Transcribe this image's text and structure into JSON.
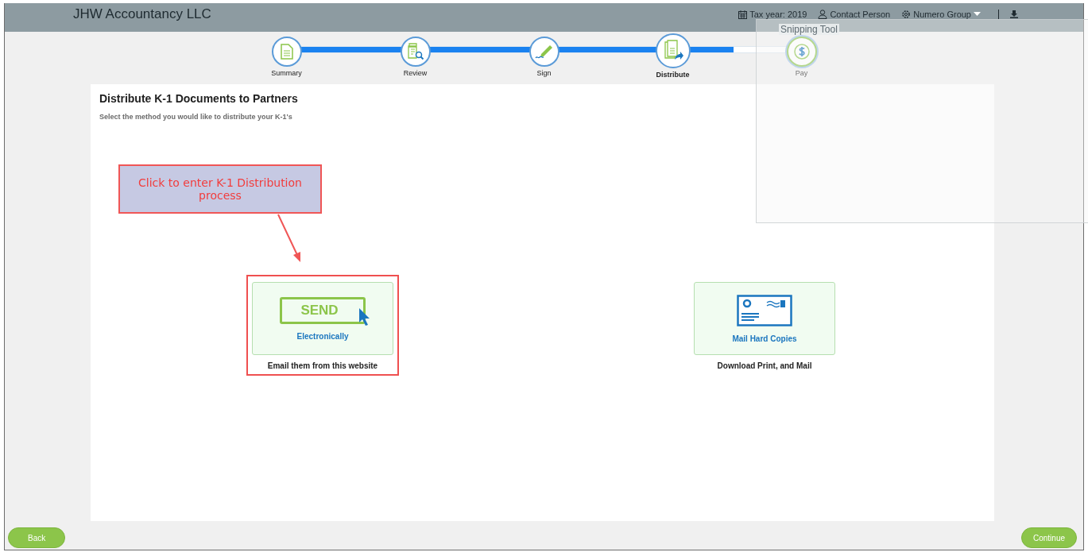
{
  "header": {
    "title": "JHW Accountancy LLC",
    "tax_year": "Tax year: 2019",
    "contact": "Contact Person",
    "group": "Numero Group"
  },
  "overlay_window": {
    "title": "Snipping Tool"
  },
  "steps": [
    {
      "label": "Summary",
      "kind": "summary",
      "completed": true,
      "selected": false
    },
    {
      "label": "Review",
      "kind": "review",
      "completed": true,
      "selected": false
    },
    {
      "label": "Sign",
      "kind": "sign",
      "completed": true,
      "selected": false
    },
    {
      "label": "Distribute",
      "kind": "distribute",
      "completed": true,
      "selected": true
    },
    {
      "label": "Pay",
      "kind": "pay",
      "completed": false,
      "selected": false
    }
  ],
  "panel": {
    "title": "Distribute K-1 Documents to Partners",
    "subtitle": "Select the method you would like to distribute your K-1's"
  },
  "callout": {
    "text": "Click to enter K-1 Distribution process"
  },
  "options": [
    {
      "kind": "send",
      "label": "Electronically",
      "caption": "Email them from this website",
      "highlighted": true,
      "send_text": "SEND"
    },
    {
      "kind": "mail",
      "label": "Mail Hard Copies",
      "caption": "Download Print, and Mail",
      "highlighted": false
    }
  ],
  "footer": {
    "back": "Back",
    "continue": "Continue"
  }
}
